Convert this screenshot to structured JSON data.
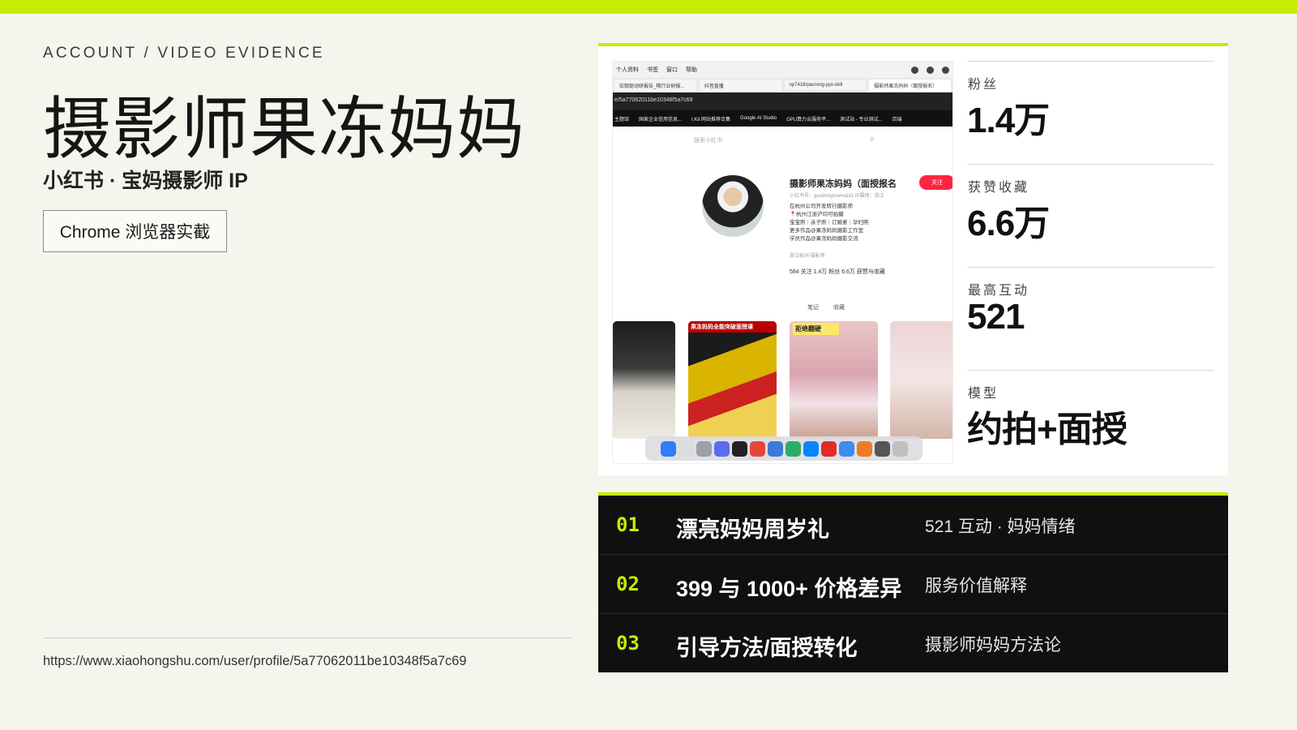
{
  "colors": {
    "accent": "#c6ec00",
    "background": "#f5f5ee",
    "dark_panel": "#101010",
    "follow_button": "#ff2442"
  },
  "header": {
    "eyebrow": "ACCOUNT / VIDEO EVIDENCE",
    "title": "摄影师果冻妈妈",
    "subtitle": "小红书 · 宝妈摄影师 IP",
    "badge": "Chrome 浏览器实截"
  },
  "footer": {
    "url": "https://www.xiaohongshu.com/user/profile/5a77062011be10348f5a7c69"
  },
  "screenshot": {
    "menubar": [
      "个人资料",
      "书签",
      "窗口",
      "帮助"
    ],
    "tabs": [
      "宏观驱动研报告_稀行业研报...",
      "抖音直播",
      "np7418/pacrong-ppt-skill",
      "摄影师果冻妈妈（面授报名）"
    ],
    "address": "e/5a77062011be10348f5a7c69",
    "bookmarks": [
      "主题馆",
      "国家企业信用信息...",
      "I.Kit 网站推荐合集",
      "Google AI Studio",
      "GPU算力云服务平...",
      "测试站 - 专业测试...",
      "百瑞"
    ],
    "search_placeholder": "搜索小红书",
    "search_icon": "search-icon",
    "profile": {
      "name": "摄影师果冻妈妈（面授报名",
      "follow_label": "关注",
      "id_line": "小红书号：guodongmama111   IP属地：浙江",
      "bio": [
        "在杭州公司开发转行摄影师",
        "📍杭州江浙沪均可拍摄",
        "宝宝照｜亲子照｜订婚宴｜孕妇照",
        "更多作品@果冻妈妈摄影工作室",
        "学员作品@果冻妈妈摄影交流"
      ],
      "location": "浙江杭州    摄影师",
      "stats": "584 关注   1.4万 粉丝   6.6万 获赞与收藏",
      "tab_notes": "笔记",
      "tab_collect": "收藏"
    },
    "thumb_labels": [
      "",
      "果冻妈妈全能突破面授课",
      "拒绝翻硬",
      ""
    ]
  },
  "stats": [
    {
      "label": "粉丝",
      "value": "1.4万"
    },
    {
      "label": "获赞收藏",
      "value": "6.6万"
    },
    {
      "label": "最高互动",
      "value": "521"
    },
    {
      "label": "模型",
      "value": "约拍+面授"
    }
  ],
  "list": [
    {
      "num": "01",
      "title": "漂亮妈妈周岁礼",
      "desc": "521 互动 · 妈妈情绪"
    },
    {
      "num": "02",
      "title": "399 与 1000+ 价格差异",
      "desc": "服务价值解释"
    },
    {
      "num": "03",
      "title": "引导方法/面授转化",
      "desc": "摄影师妈妈方法论"
    }
  ]
}
